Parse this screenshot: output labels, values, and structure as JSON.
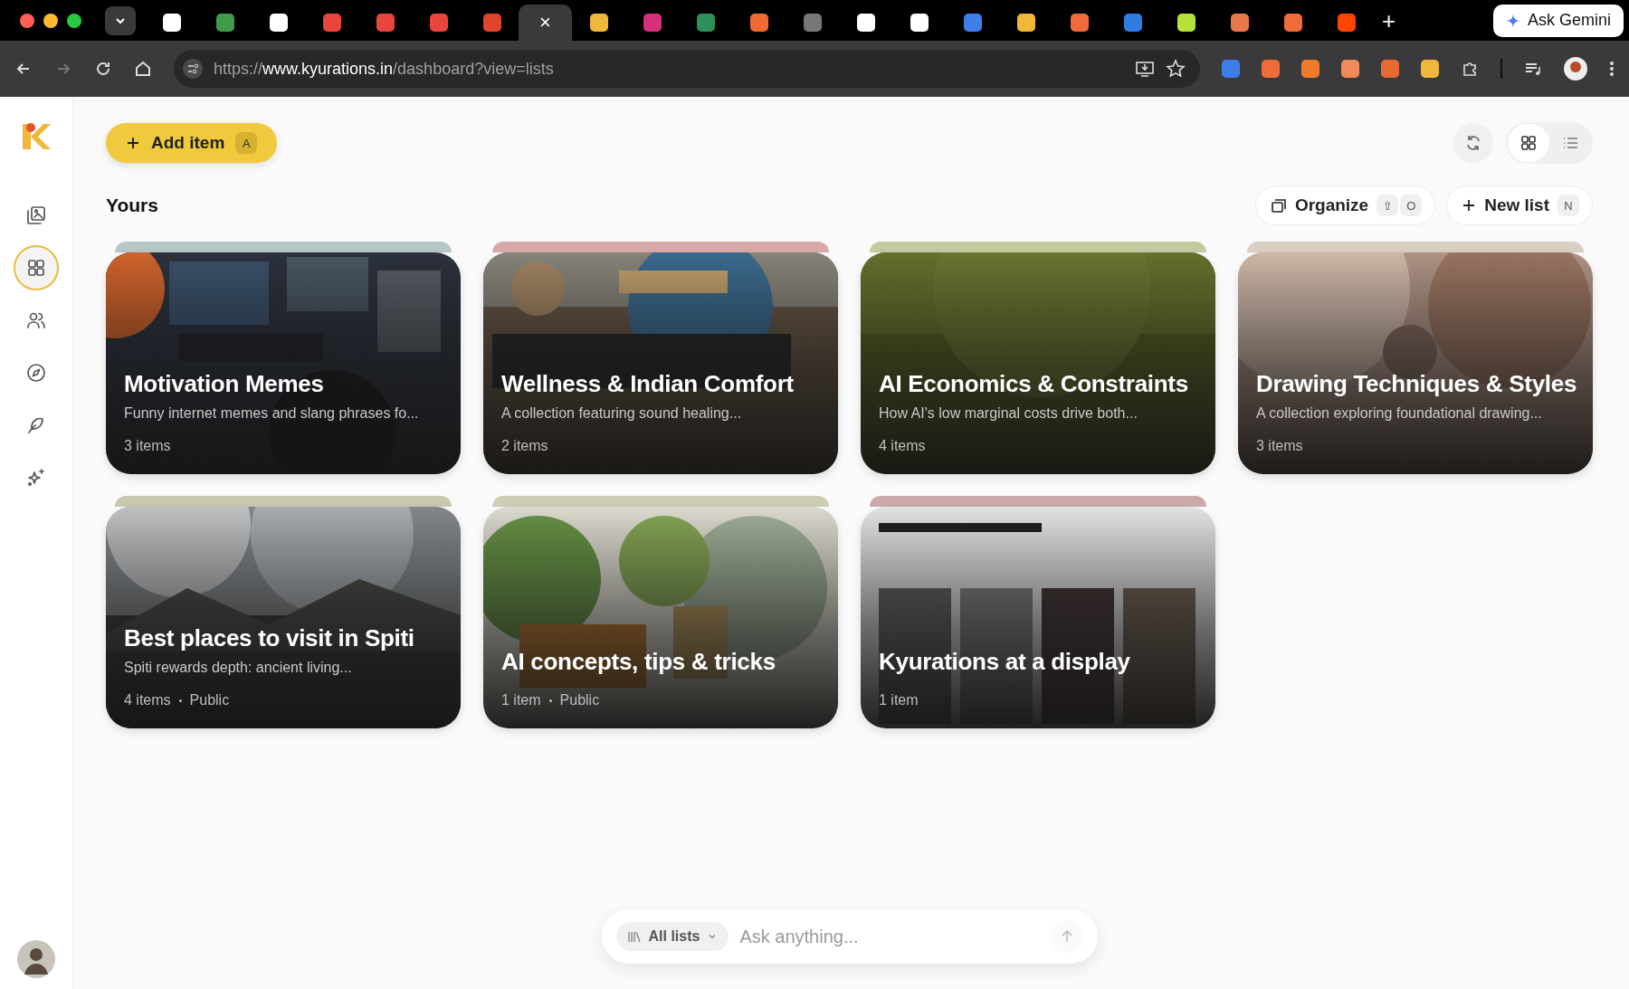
{
  "browser": {
    "tabs": [
      {
        "selected": false
      },
      {
        "selected": false
      },
      {
        "selected": false
      },
      {
        "selected": false
      },
      {
        "selected": false
      },
      {
        "selected": false
      },
      {
        "selected": false
      },
      {
        "selected": true
      },
      {
        "selected": false
      },
      {
        "selected": false
      },
      {
        "selected": false
      },
      {
        "selected": false
      },
      {
        "selected": false
      },
      {
        "selected": false
      },
      {
        "selected": false
      },
      {
        "selected": false
      },
      {
        "selected": false
      },
      {
        "selected": false
      },
      {
        "selected": false
      },
      {
        "selected": false
      },
      {
        "selected": false
      },
      {
        "selected": false
      },
      {
        "selected": false
      }
    ],
    "close_glyph": "×",
    "new_tab_glyph": "+",
    "gemini": "Ask Gemini",
    "url": {
      "scheme": "https://",
      "host": "www.kyurations.in",
      "path": "/dashboard?view=lists"
    }
  },
  "sidebar": {
    "items": [
      {
        "kind": "gallery",
        "selected": false
      },
      {
        "kind": "grid",
        "selected": true
      },
      {
        "kind": "people",
        "selected": false
      },
      {
        "kind": "compass",
        "selected": false
      },
      {
        "kind": "feather",
        "selected": false
      },
      {
        "kind": "sparkles",
        "selected": false
      }
    ]
  },
  "add_button": {
    "label": "Add item",
    "shortcut": "A"
  },
  "view_toggle": [
    {
      "kind": "grid",
      "selected": true
    },
    {
      "kind": "list",
      "selected": false
    }
  ],
  "section": {
    "title": "Yours"
  },
  "organize": {
    "label": "Organize",
    "shortcuts": [
      "⇧",
      "O"
    ]
  },
  "new_list": {
    "label": "New list",
    "shortcut": "N"
  },
  "lists": [
    {
      "title": "Motivation Memes",
      "description": "Funny internet memes and slang phrases fo...",
      "count": "3 items"
    },
    {
      "title": "Wellness & Indian Comfort",
      "description": "A collection featuring sound healing...",
      "count": "2 items"
    },
    {
      "title": "AI Economics & Constraints",
      "description": "How AI's low marginal costs drive both...",
      "count": "4 items"
    },
    {
      "title": "Drawing Techniques & Styles",
      "description": "A collection exploring foundational drawing...",
      "count": "3 items"
    },
    {
      "title": "Best places to visit in Spiti",
      "description": "Spiti rewards depth: ancient living...",
      "count": "4 items",
      "visibility": "Public"
    },
    {
      "title": "AI concepts, tips & tricks",
      "count": "1 item",
      "visibility": "Public"
    },
    {
      "title": "Kyurations at a display",
      "count": "1 item"
    }
  ],
  "ask": {
    "scope": "All lists",
    "placeholder": "Ask anything..."
  }
}
